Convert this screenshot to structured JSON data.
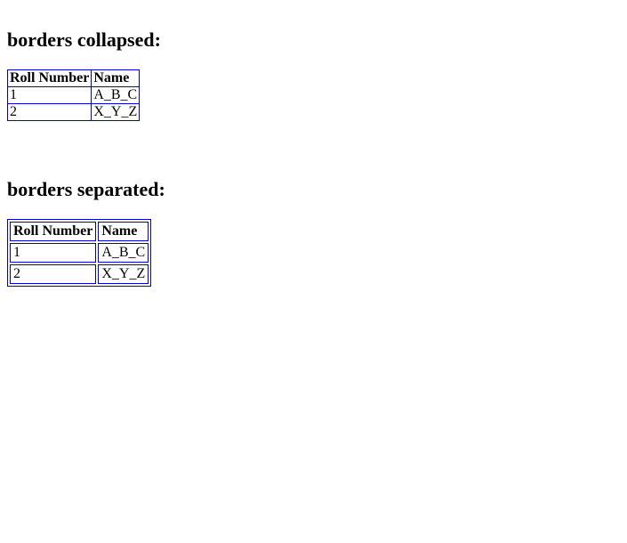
{
  "section1": {
    "heading": "borders collapsed:",
    "headers": [
      "Roll Number",
      "Name"
    ],
    "rows": [
      [
        "1",
        "A_B_C"
      ],
      [
        "2",
        "X_Y_Z"
      ]
    ]
  },
  "section2": {
    "heading": "borders separated:",
    "headers": [
      "Roll Number",
      "Name"
    ],
    "rows": [
      [
        "1",
        "A_B_C"
      ],
      [
        "2",
        "X_Y_Z"
      ]
    ]
  }
}
